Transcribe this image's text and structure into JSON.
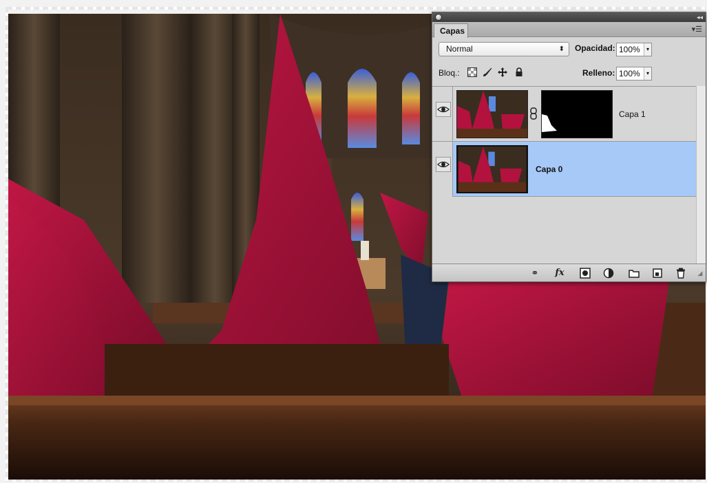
{
  "panel": {
    "tab_label": "Capas",
    "blend_mode": "Normal",
    "opacity_label": "Opacidad:",
    "opacity_value": "100%",
    "lock_label": "Bloq.:",
    "fill_label": "Relleno:",
    "fill_value": "100%",
    "layers": [
      {
        "name": "Capa 1",
        "has_mask": true,
        "visible": true,
        "selected": false
      },
      {
        "name": "Capa 0",
        "has_mask": false,
        "visible": true,
        "selected": true
      }
    ],
    "footer_icons": [
      "link-layers-icon",
      "fx-icon",
      "add-mask-icon",
      "adjustment-layer-icon",
      "new-group-icon",
      "new-layer-icon",
      "trash-icon"
    ],
    "footer_fx": "fx"
  },
  "colors": {
    "selection": "#a7c9f8",
    "hood_red": "#a8123a",
    "panel_bg": "#d6d6d6"
  }
}
